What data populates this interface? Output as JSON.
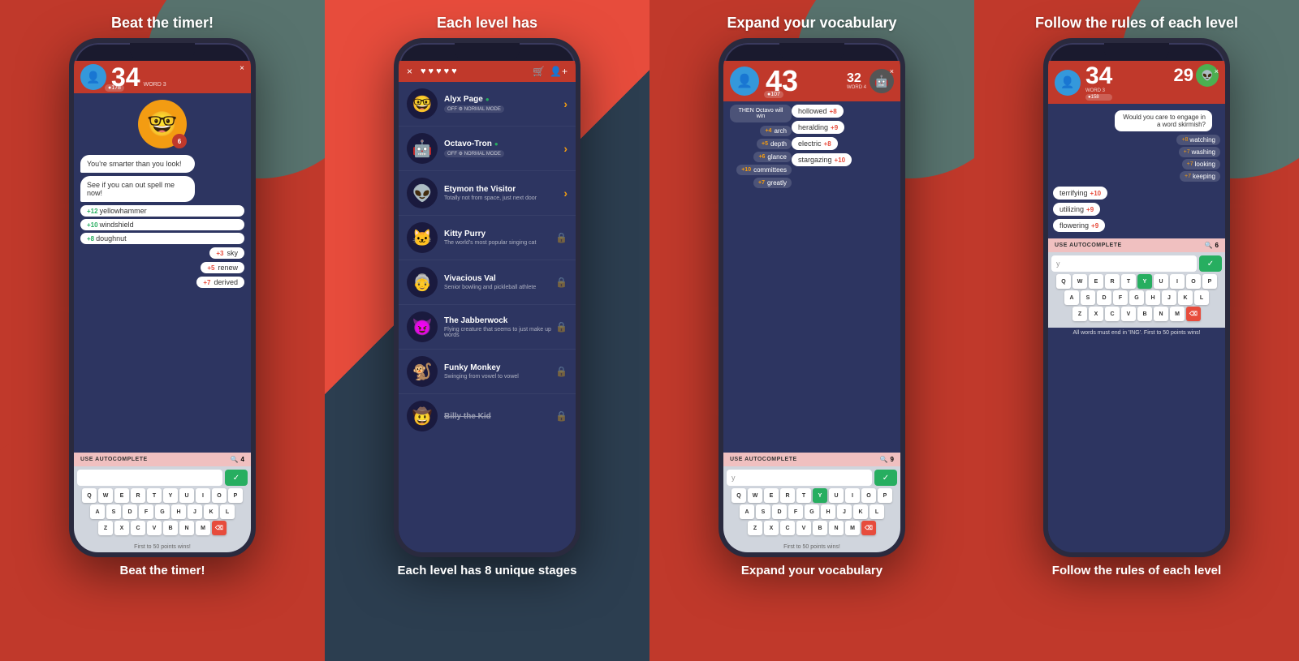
{
  "panel1": {
    "caption": "Beat the timer!",
    "caption_bottom": "First to 50 points wins!",
    "header": {
      "score": "34",
      "word_label": "WORD 3",
      "points_badge": "●178",
      "close": "×"
    },
    "emoji": "🤓",
    "emoji_badge": "6",
    "chat": [
      "You're smarter than you look!",
      "See if you can out spell me now!"
    ],
    "words_left": [
      {
        "label": "yellowhammer",
        "score": "+12"
      },
      {
        "label": "windshield",
        "score": "+10"
      },
      {
        "label": "doughnut",
        "score": "+8"
      }
    ],
    "words_right": [
      {
        "score": "+3",
        "label": "sky"
      },
      {
        "score": "+5",
        "label": "renew"
      },
      {
        "score": "+7",
        "label": "derived"
      }
    ],
    "autocomplete": {
      "label": "USE AUTOCOMPLETE",
      "count": "4"
    },
    "keyboard": {
      "rows": [
        [
          "Q",
          "W",
          "E",
          "R",
          "T",
          "Y",
          "U",
          "I",
          "O",
          "P"
        ],
        [
          "A",
          "S",
          "D",
          "F",
          "G",
          "H",
          "J",
          "K",
          "L"
        ],
        [
          "Z",
          "X",
          "C",
          "V",
          "B",
          "N",
          "M",
          "⌫"
        ]
      ]
    }
  },
  "panel2": {
    "caption": "Each level has 8 unique stages",
    "header": {
      "close": "×",
      "hearts": [
        "♥",
        "♥",
        "♥",
        "♥",
        "♥"
      ],
      "cart": "🛒",
      "add_user": "👤+"
    },
    "opponents": [
      {
        "emoji": "🤓",
        "name": "Alyx Page",
        "online": true,
        "mode": "NORMAL MODE",
        "unlocked": true
      },
      {
        "emoji": "🤖",
        "name": "Octavo-Tron",
        "online": true,
        "mode": "NORMAL MODE",
        "unlocked": true
      },
      {
        "emoji": "👽",
        "name": "Etymon the Visitor",
        "desc": "Totally not from space, just next door",
        "online": false,
        "unlocked": true
      },
      {
        "emoji": "🐱",
        "name": "Kitty Purry",
        "desc": "The world's most popular singing cat",
        "online": false,
        "unlocked": false
      },
      {
        "emoji": "👵",
        "name": "Vivacious Val",
        "desc": "Senior bowling and pickleball athlete",
        "online": false,
        "unlocked": false
      },
      {
        "emoji": "😈",
        "name": "The Jabberwock",
        "desc": "Flying creature that seems to just make up words",
        "online": false,
        "unlocked": false
      },
      {
        "emoji": "🐒",
        "name": "Funky Monkey",
        "desc": "Swinging from vowel to vowel",
        "online": false,
        "unlocked": false
      },
      {
        "emoji": "🤠",
        "name": "Billy the Kid",
        "desc": "",
        "online": false,
        "unlocked": false
      }
    ]
  },
  "panel3": {
    "caption": "Expand your vocabulary",
    "caption_bottom": "First to 50 points wins!",
    "header": {
      "player_score": "43",
      "opp_score": "32",
      "word_label": "WORD 4",
      "player_points": "●107",
      "close": "×"
    },
    "notice": "THEN Octavo will win",
    "right_words": [
      {
        "score": "+4",
        "label": "arch"
      },
      {
        "score": "+5",
        "label": "depth"
      },
      {
        "score": "+6",
        "label": "glance"
      },
      {
        "score": "+10",
        "label": "committees"
      },
      {
        "score": "+7",
        "label": "greatly"
      }
    ],
    "left_words": [
      {
        "label": "hollowed",
        "score": "+8"
      },
      {
        "label": "heralding",
        "score": "+9"
      },
      {
        "label": "electric",
        "score": "+8"
      },
      {
        "label": "stargazing",
        "score": "+10"
      }
    ],
    "autocomplete": {
      "label": "USE AUTOCOMPLETE",
      "count": "9"
    }
  },
  "panel4": {
    "caption": "Follow the rules of each level",
    "header": {
      "player_score": "34",
      "word_label": "WORD 3",
      "opp_score": "29",
      "player_points": "●158",
      "close": "×"
    },
    "chat_bubble": "Would you care to engage in a word skirmish?",
    "right_words": [
      {
        "score": "+8",
        "label": "watching"
      },
      {
        "score": "+7",
        "label": "washing"
      },
      {
        "score": "+7",
        "label": "looking"
      },
      {
        "score": "+7",
        "label": "keeping"
      }
    ],
    "left_words": [
      {
        "label": "terrifying",
        "score": "+10"
      },
      {
        "label": "utilizing",
        "score": "+9"
      },
      {
        "label": "flowering",
        "score": "+9"
      }
    ],
    "autocomplete": {
      "label": "USE AUTOCOMPLETE",
      "count": "6"
    },
    "rule_text": "All words must end in 'ING'. First to 50 points wins!"
  }
}
